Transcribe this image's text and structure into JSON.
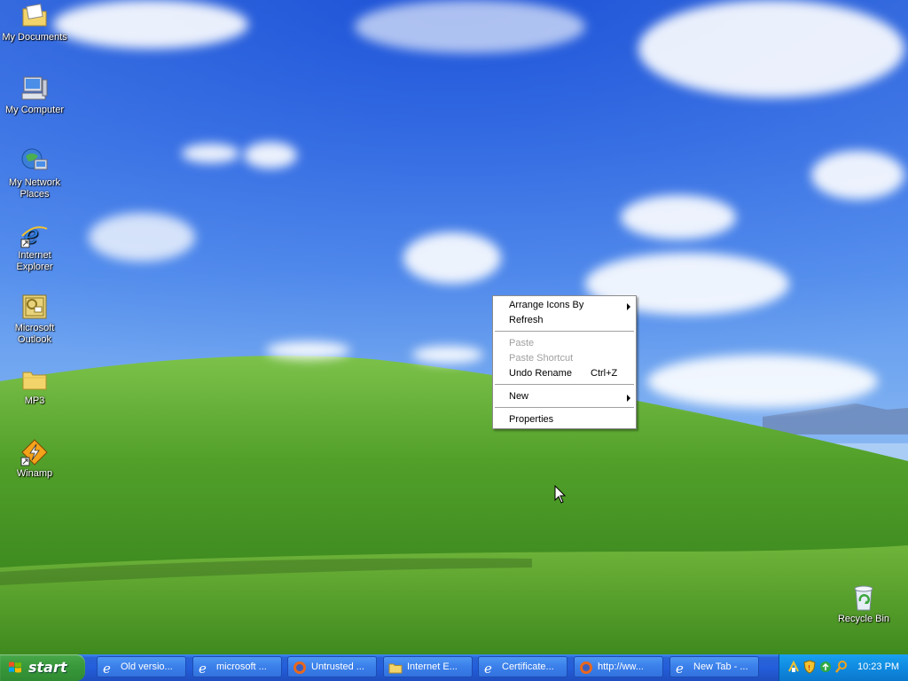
{
  "desktop": {
    "icons": [
      {
        "label": "My Documents",
        "icon": "my-documents-icon"
      },
      {
        "label": "My Computer",
        "icon": "my-computer-icon"
      },
      {
        "label": "My Network Places",
        "icon": "network-places-icon"
      },
      {
        "label": "Internet Explorer",
        "icon": "internet-explorer-icon"
      },
      {
        "label": "Microsoft Outlook",
        "icon": "outlook-icon"
      },
      {
        "label": "MP3",
        "icon": "folder-icon"
      },
      {
        "label": "Winamp",
        "icon": "winamp-icon"
      },
      {
        "label": "Recycle Bin",
        "icon": "recycle-bin-icon"
      }
    ]
  },
  "context_menu": {
    "items": [
      {
        "label": "Arrange Icons By",
        "has_submenu": true,
        "enabled": true
      },
      {
        "label": "Refresh",
        "enabled": true
      },
      {
        "label": "Paste",
        "enabled": false
      },
      {
        "label": "Paste Shortcut",
        "enabled": false
      },
      {
        "label": "Undo Rename",
        "shortcut": "Ctrl+Z",
        "enabled": true
      },
      {
        "label": "New",
        "has_submenu": true,
        "enabled": true
      },
      {
        "label": "Properties",
        "enabled": true
      }
    ]
  },
  "taskbar": {
    "start_label": "start",
    "buttons": [
      {
        "label": "Old versio...",
        "icon": "ie-icon"
      },
      {
        "label": "microsoft ...",
        "icon": "ie-icon"
      },
      {
        "label": "Untrusted ...",
        "icon": "firefox-icon"
      },
      {
        "label": "Internet E...",
        "icon": "folder-icon"
      },
      {
        "label": "Certificate...",
        "icon": "ie-icon"
      },
      {
        "label": "http://ww...",
        "icon": "firefox-icon"
      },
      {
        "label": "New Tab - ...",
        "icon": "ie-icon"
      }
    ],
    "tray": {
      "icons": [
        "network-icon",
        "security-shield-icon",
        "update-icon",
        "search-icon"
      ],
      "clock": "10:23 PM"
    }
  },
  "colors": {
    "taskbar_blue": "#245edb",
    "start_green": "#3a9a3c",
    "tray_blue": "#0f8ae0",
    "sky_blue": "#2e66e6",
    "grass_green": "#5aa42e"
  }
}
